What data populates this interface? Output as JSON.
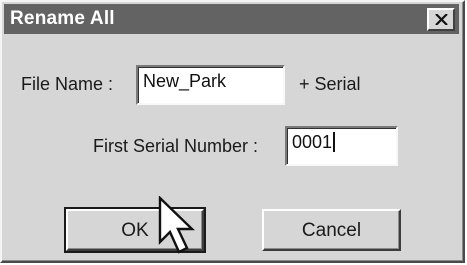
{
  "window": {
    "title": "Rename All",
    "close_glyph": "X"
  },
  "form": {
    "file_name_label": "File Name :",
    "file_name_value": "New_Park",
    "serial_suffix": "+ Serial",
    "first_serial_label": "First Serial Number :",
    "first_serial_value": "0001"
  },
  "buttons": {
    "ok_label": "OK",
    "cancel_label": "Cancel"
  },
  "icons": {
    "close": "close-icon",
    "cursor": "mouse-pointer-icon"
  },
  "colors": {
    "titlebar": "#636363",
    "dialog_face": "#d6d6d6",
    "field_bg": "#ffffff"
  }
}
